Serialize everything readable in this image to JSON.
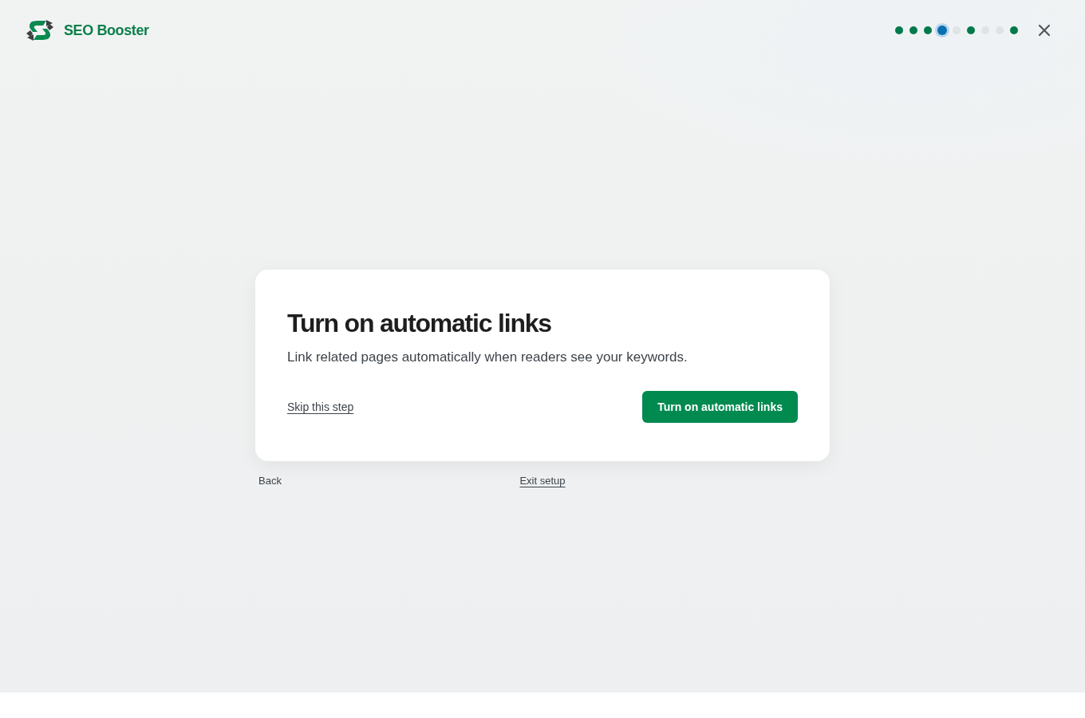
{
  "header": {
    "brand": "SEO Booster",
    "steps": [
      {
        "kind": "complete"
      },
      {
        "kind": "complete"
      },
      {
        "kind": "complete"
      },
      {
        "kind": "current"
      },
      {
        "kind": "upcoming"
      },
      {
        "kind": "complete"
      },
      {
        "kind": "upcoming"
      },
      {
        "kind": "upcoming"
      },
      {
        "kind": "complete"
      }
    ]
  },
  "card": {
    "title": "Turn on automatic links",
    "description": "Link related pages automatically when readers see your keywords.",
    "skip_link": "Skip this step",
    "primary_button": "Turn on automatic links"
  },
  "footer": {
    "back": "Back",
    "exit": "Exit setup"
  }
}
